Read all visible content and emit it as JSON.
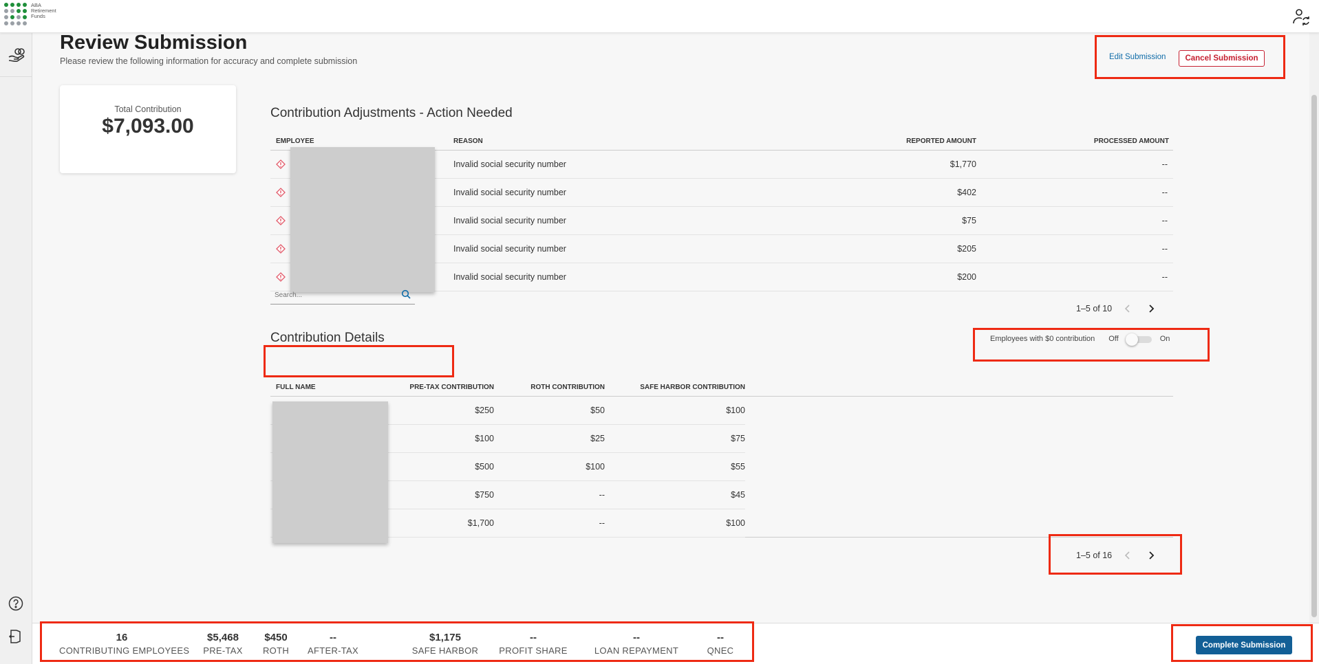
{
  "brand": {
    "logo_text": "ABA Retirement Funds",
    "logo_text_lines": [
      "ABA",
      "Retirement",
      "Funds"
    ],
    "dot_colors": [
      "#1f8f3a",
      "#1f8f3a",
      "#1f8f3a",
      "#1f8f3a",
      "#9aa0a6",
      "#9aa0a6",
      "#1f8f3a",
      "#1f8f3a",
      "#9aa0a6",
      "#1f8f3a",
      "#9aa0a6",
      "#1f8f3a",
      "#9aa0a6",
      "#9aa0a6",
      "#9aa0a6",
      "#9aa0a6"
    ]
  },
  "header": {
    "title": "Review Submission",
    "subtitle": "Please review the following information for accuracy and complete submission",
    "edit_label": "Edit Submission",
    "cancel_label": "Cancel Submission"
  },
  "total": {
    "label": "Total Contribution",
    "value": "$7,093.00"
  },
  "adjustments": {
    "title": "Contribution Adjustments - Action Needed",
    "columns": [
      "EMPLOYEE",
      "REASON",
      "REPORTED AMOUNT",
      "PROCESSED AMOUNT"
    ],
    "rows": [
      {
        "reason": "Invalid social security number",
        "reported": "$1,770",
        "processed": "--"
      },
      {
        "reason": "Invalid social security number",
        "reported": "$402",
        "processed": "--"
      },
      {
        "reason": "Invalid social security number",
        "reported": "$75",
        "processed": "--"
      },
      {
        "reason": "Invalid social security number",
        "reported": "$205",
        "processed": "--"
      },
      {
        "reason": "Invalid social security number",
        "reported": "$200",
        "processed": "--"
      }
    ],
    "pager": "1–5 of 10"
  },
  "details": {
    "title": "Contribution Details",
    "search_placeholder": "Search...",
    "toggle_label": "Employees with $0 contribution",
    "toggle_off": "Off",
    "toggle_on": "On",
    "columns": [
      "FULL NAME",
      "PRE-TAX CONTRIBUTION",
      "ROTH CONTRIBUTION",
      "SAFE HARBOR CONTRIBUTION"
    ],
    "rows": [
      {
        "pretax": "$250",
        "roth": "$50",
        "safe": "$100"
      },
      {
        "pretax": "$100",
        "roth": "$25",
        "safe": "$75"
      },
      {
        "pretax": "$500",
        "roth": "$100",
        "safe": "$55"
      },
      {
        "pretax": "$750",
        "roth": "--",
        "safe": "$45"
      },
      {
        "pretax": "$1,700",
        "roth": "--",
        "safe": "$100"
      }
    ],
    "pager": "1–5 of 16"
  },
  "footer": {
    "stats": [
      {
        "value": "16",
        "label": "CONTRIBUTING EMPLOYEES"
      },
      {
        "value": "$5,468",
        "label": "PRE-TAX"
      },
      {
        "value": "$450",
        "label": "ROTH"
      },
      {
        "value": "--",
        "label": "AFTER-TAX"
      },
      {
        "value": "$1,175",
        "label": "SAFE HARBOR"
      },
      {
        "value": "--",
        "label": "PROFIT SHARE"
      },
      {
        "value": "--",
        "label": "LOAN REPAYMENT"
      },
      {
        "value": "--",
        "label": "QNEC"
      }
    ],
    "complete_label": "Complete Submission"
  },
  "colors": {
    "accent": "#125f96",
    "link": "#0e6ba8",
    "danger": "#c62031",
    "highlight": "#ee2a13"
  }
}
